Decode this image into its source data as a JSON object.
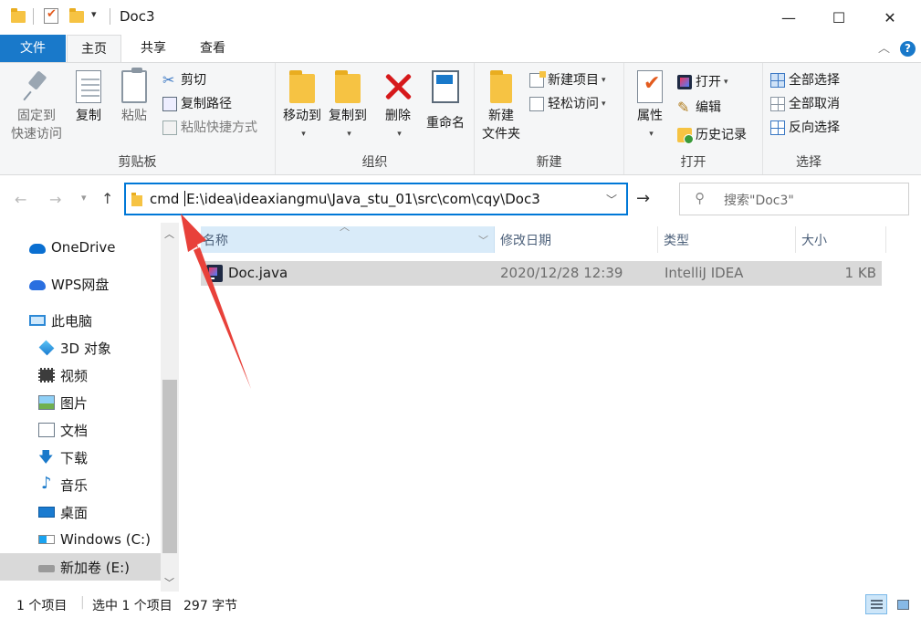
{
  "window": {
    "title": "Doc3",
    "controls": {
      "minimize": "—",
      "maximize": "☐",
      "close": "✕"
    }
  },
  "quick_access": {
    "dropdown": "▾"
  },
  "ribbon_tabs": [
    {
      "label": "文件"
    },
    {
      "label": "主页"
    },
    {
      "label": "共享"
    },
    {
      "label": "查看"
    }
  ],
  "ribbon": {
    "clipboard": {
      "label": "剪贴板",
      "pin": "固定到\n快速访问",
      "pin_line1": "固定到",
      "pin_line2": "快速访问",
      "copy": "复制",
      "paste": "粘贴",
      "cut": "剪切",
      "copy_path": "复制路径",
      "paste_shortcut": "粘贴快捷方式"
    },
    "organize": {
      "label": "组织",
      "move_to": "移动到",
      "copy_to": "复制到",
      "delete": "删除",
      "rename": "重命名"
    },
    "new": {
      "label": "新建",
      "new_folder_line1": "新建",
      "new_folder_line2": "文件夹",
      "new_item": "新建项目",
      "easy_access": "轻松访问"
    },
    "open": {
      "label": "打开",
      "properties": "属性",
      "open": "打开",
      "edit": "编辑",
      "history": "历史记录"
    },
    "select": {
      "label": "选择",
      "select_all": "全部选择",
      "select_none": "全部取消",
      "invert": "反向选择"
    }
  },
  "address": {
    "typed_prefix": "cmd ",
    "path": "E:\\idea\\ideaxiangmu\\Java_stu_01\\src\\com\\cqy\\Doc3"
  },
  "search": {
    "placeholder": "搜索\"Doc3\""
  },
  "nav_pane": [
    {
      "label": "OneDrive",
      "icon": "onedrive-cloud-icon"
    },
    {
      "label": "WPS网盘",
      "icon": "wps-cloud-icon"
    },
    {
      "label": "此电脑",
      "icon": "computer-icon"
    },
    {
      "label": "3D 对象",
      "icon": "3d-objects-icon"
    },
    {
      "label": "视频",
      "icon": "video-icon"
    },
    {
      "label": "图片",
      "icon": "pictures-icon"
    },
    {
      "label": "文档",
      "icon": "documents-icon"
    },
    {
      "label": "下载",
      "icon": "downloads-icon"
    },
    {
      "label": "音乐",
      "icon": "music-icon"
    },
    {
      "label": "桌面",
      "icon": "desktop-icon"
    },
    {
      "label": "Windows (C:)",
      "icon": "windows-drive-icon"
    },
    {
      "label": "新加卷 (E:)",
      "icon": "drive-icon",
      "selected": true
    }
  ],
  "columns": {
    "name": "名称",
    "modified": "修改日期",
    "type": "类型",
    "size": "大小"
  },
  "files": [
    {
      "name": "Doc.java",
      "modified": "2020/12/28 12:39",
      "type": "IntelliJ IDEA",
      "size": "1 KB",
      "selected": true
    }
  ],
  "status": {
    "item_count": "1 个项目",
    "selection": "选中 1 个项目",
    "selection_size": "297 字节"
  },
  "colors": {
    "accent": "#1979ca",
    "selection": "#d9d9d9",
    "annotation": "#e8413a"
  }
}
